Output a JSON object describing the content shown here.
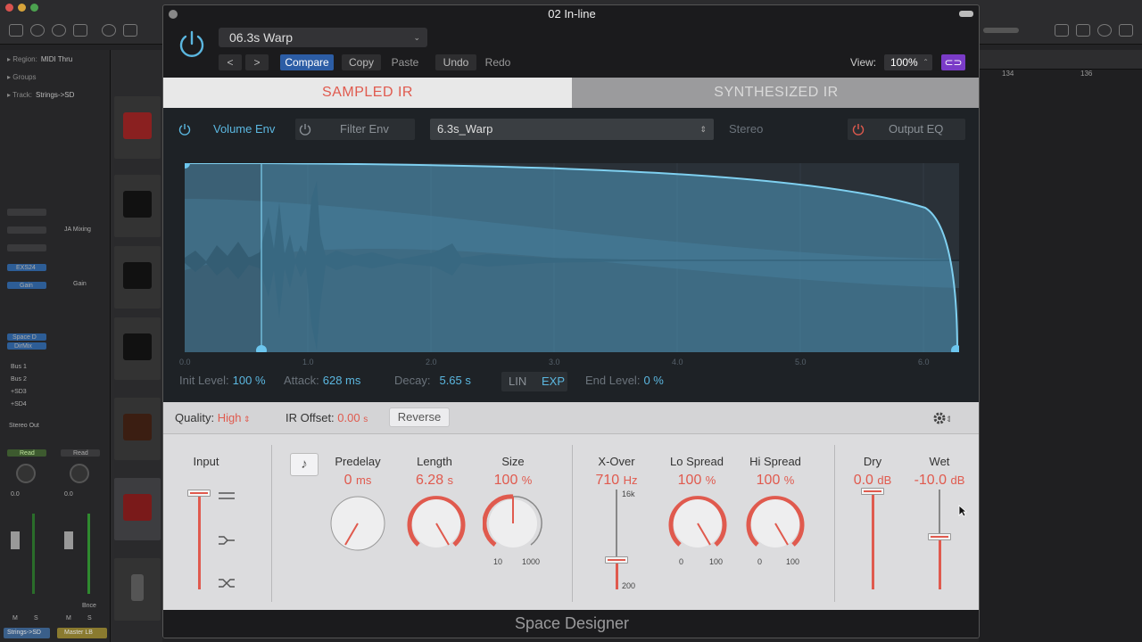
{
  "host": {
    "region_label": "Region:",
    "region_value": "MIDI Thru",
    "groups_label": "Groups",
    "track_label": "Track:",
    "track_value": "Strings->SD",
    "ruler_ticks": [
      "134",
      "136"
    ],
    "ch_labels": [
      "EXS24",
      "Gain",
      "Space D",
      "DirMix",
      "Bus 1",
      "Bus 2",
      "+SD3",
      "+SD4",
      "Stereo Out",
      "Read",
      "Read",
      "0.0",
      "0.0",
      "Bnce",
      "M",
      "S",
      "M",
      "S"
    ],
    "track_name_1": "Strings->SD",
    "track_name_2": "Master LB",
    "insert_label_1": "JA Mixing",
    "insert_label_2": "Gain"
  },
  "window": {
    "title": "02 In-line"
  },
  "toolbar": {
    "preset": "06.3s Warp",
    "prev": "<",
    "next": ">",
    "compare": "Compare",
    "copy": "Copy",
    "paste": "Paste",
    "undo": "Undo",
    "redo": "Redo",
    "view_label": "View:",
    "view_value": "100%"
  },
  "tabs": {
    "sampled": "SAMPLED IR",
    "synthesized": "SYNTHESIZED IR"
  },
  "editor": {
    "volume_env": "Volume Env",
    "filter_env": "Filter Env",
    "ir_name": "6.3s_Warp",
    "stereo": "Stereo",
    "output_eq": "Output EQ",
    "axis_ticks": [
      "0.0",
      "1.0",
      "2.0",
      "3.0",
      "4.0",
      "5.0",
      "6.0"
    ],
    "init_level_label": "Init Level:",
    "init_level_value": "100 %",
    "attack_label": "Attack:",
    "attack_value": "628 ms",
    "decay_label": "Decay:",
    "decay_value": "5.65 s",
    "lin": "LIN",
    "exp": "EXP",
    "end_level_label": "End Level:",
    "end_level_value": "0 %"
  },
  "strip": {
    "quality_label": "Quality:",
    "quality_value": "High",
    "ir_offset_label": "IR Offset:",
    "ir_offset_value": "0.00",
    "ir_offset_unit": "s",
    "reverse": "Reverse"
  },
  "controls": {
    "input_title": "Input",
    "predelay_title": "Predelay",
    "predelay_value": "0",
    "predelay_unit": "ms",
    "length_title": "Length",
    "length_value": "6.28",
    "length_unit": "s",
    "size_title": "Size",
    "size_value": "100",
    "size_unit": "%",
    "size_min": "10",
    "size_max": "1000",
    "xover_title": "X-Over",
    "xover_value": "710",
    "xover_unit": "Hz",
    "xover_top": "16k",
    "xover_bottom": "200",
    "lospread_title": "Lo Spread",
    "lospread_value": "100",
    "lospread_unit": "%",
    "lospread_min": "0",
    "lospread_max": "100",
    "hispread_title": "Hi Spread",
    "hispread_value": "100",
    "hispread_unit": "%",
    "hispread_min": "0",
    "hispread_max": "100",
    "dry_title": "Dry",
    "dry_value": "0.0",
    "dry_unit": "dB",
    "wet_title": "Wet",
    "wet_value": "-10.0",
    "wet_unit": "dB"
  },
  "footer": {
    "name": "Space Designer"
  },
  "colors": {
    "accent_red": "#e05a4e",
    "accent_blue": "#5bb7e0",
    "compare_blue": "#2c5da5",
    "link_purple": "#7a3bc7"
  }
}
